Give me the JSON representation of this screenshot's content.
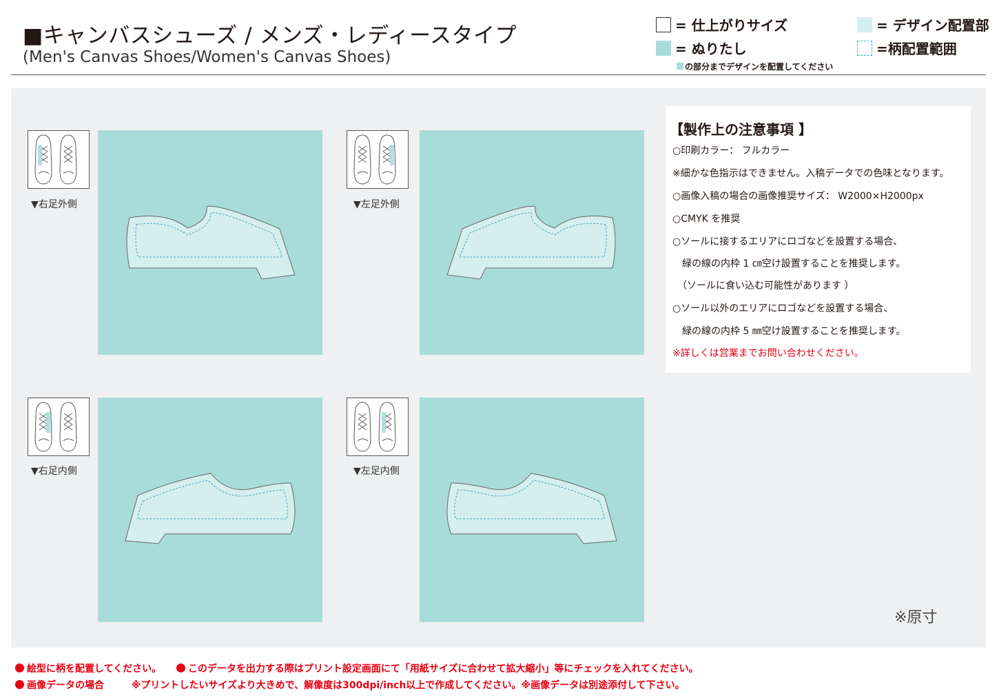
{
  "header": {
    "title_jp": "■キャンバスシューズ / メンズ・レディースタイプ",
    "title_en": "(Men's Canvas Shoes/Women's Canvas Shoes)"
  },
  "legend": {
    "finish_size": "= 仕上がりサイズ",
    "bleed": "= ぬりたし",
    "design_area": "= デザイン配置部",
    "pattern_range": "=柄配置範囲",
    "note": "の部分までデザインを配置してください"
  },
  "colors": {
    "bleed": "#a8dcd9",
    "design_area": "#d4efed",
    "pattern_line": "#4aa3c8",
    "warning_red": "#e60012",
    "canvas_bg": "#eff0f1"
  },
  "panels": [
    {
      "label": "▼右足外側"
    },
    {
      "label": "▼左足外側"
    },
    {
      "label": "▼右足内側"
    },
    {
      "label": "▼左足内側"
    }
  ],
  "notes": {
    "title": "【製作上の注意事項 】",
    "lines": [
      "○印刷カラー： フルカラー",
      "※細かな色指示はできません。入稿データでの色味となります。",
      "○画像入稿の場合の画像推奨サイズ： W2000×H2000px",
      "○CMYK を推奨",
      "○ソールに接するエリアにロゴなどを設置する場合、",
      "　緑の線の内枠 1 ㎝空け設置することを推奨します。",
      "　（ソールに食い込む可能性があります ）",
      "○ソール以外のエリアにロゴなどを設置する場合、",
      "　緑の線の内枠 5 ㎜空け設置することを推奨します。"
    ],
    "red_line": "※詳しくは営業までお問い合わせください。"
  },
  "scale_note": "※原寸",
  "footer": {
    "line1_a": "絵型に柄を配置してください。",
    "line1_b": "このデータを出力する際はプリント設定画面にて「用紙サイズに合わせて拡大縮小」等にチェックを入れてください。",
    "line2_a": "画像データの場合",
    "line2_b": "※プリントしたいサイズより大きめで、解像度は300dpi/inch以上で作成してください。※画像データは別途添付して下さい。"
  }
}
